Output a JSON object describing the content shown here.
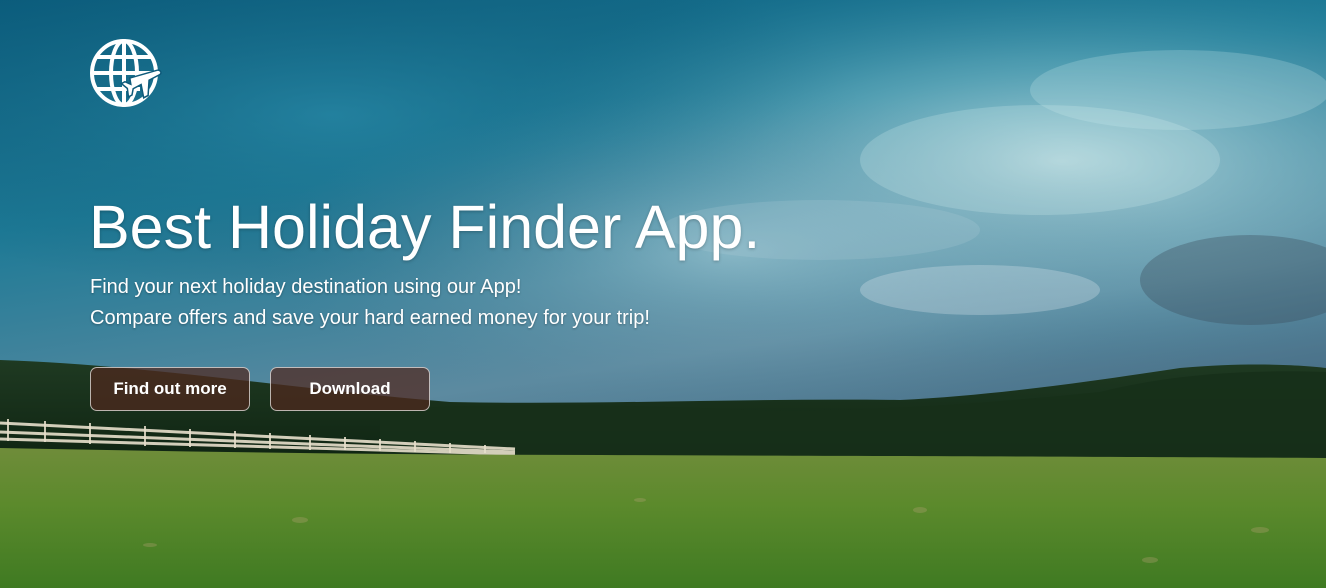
{
  "hero": {
    "logo_icon": "globe-airplane-icon",
    "headline": "Best Holiday Finder App.",
    "subtitle_line1": "Find your next holiday destination using our App!",
    "subtitle_line2": "Compare offers and save your hard earned money for your trip!",
    "buttons": {
      "find_out_more": "Find out more",
      "download": "Download"
    }
  },
  "colors": {
    "sky": "#0e5a7a",
    "grass": "#5a8a2a",
    "button_bg": "#50281e",
    "text": "#ffffff"
  }
}
